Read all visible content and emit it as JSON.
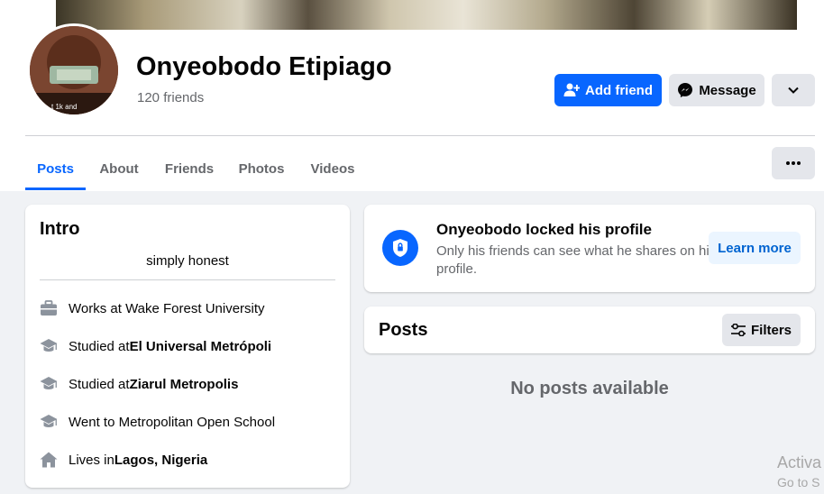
{
  "profile": {
    "name": "Onyeobodo Etipiago",
    "friends": "120 friends",
    "avatar_caption": "t 1k and"
  },
  "actions": {
    "add_friend": "Add friend",
    "message": "Message"
  },
  "tabs": [
    {
      "label": "Posts",
      "active": true
    },
    {
      "label": "About"
    },
    {
      "label": "Friends"
    },
    {
      "label": "Photos"
    },
    {
      "label": "Videos"
    }
  ],
  "intro": {
    "title": "Intro",
    "bio": "simply honest",
    "items": [
      {
        "icon": "briefcase-icon",
        "prefix": "Works at Wake Forest University",
        "bold": ""
      },
      {
        "icon": "graduation-cap-icon",
        "prefix": "Studied at ",
        "bold": "El Universal Metrópoli"
      },
      {
        "icon": "graduation-cap-icon",
        "prefix": "Studied at ",
        "bold": "Ziarul Metropolis"
      },
      {
        "icon": "graduation-cap-icon",
        "prefix": "Went to Metropolitan Open School",
        "bold": ""
      },
      {
        "icon": "home-icon",
        "prefix": "Lives in ",
        "bold": "Lagos, Nigeria"
      }
    ]
  },
  "locked": {
    "title": "Onyeobodo locked his profile",
    "description": "Only his friends can see what he shares on his profile.",
    "learn_more": "Learn more"
  },
  "posts": {
    "title": "Posts",
    "filters": "Filters",
    "empty": "No posts available"
  },
  "watermark": {
    "line1": "Activa",
    "line2": "Go to S"
  },
  "colors": {
    "accent": "#0866ff",
    "secondary_text": "#65676b",
    "button_gray": "#e4e6eb",
    "background": "#f0f2f5"
  }
}
